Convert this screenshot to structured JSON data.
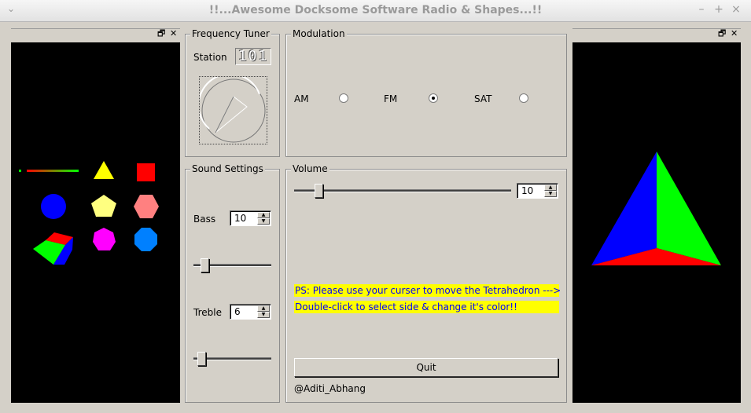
{
  "window": {
    "title": "!!...Awesome Docksome Software Radio & Shapes...!!",
    "minimize": "–",
    "maximize": "+",
    "close": "×",
    "menu": "⌄"
  },
  "left_dock": {
    "float_btn": "🗗",
    "close_btn": "✕"
  },
  "right_dock": {
    "float_btn": "🗗",
    "close_btn": "✕"
  },
  "frequency": {
    "legend": "Frequency Tuner",
    "station_label": "Station",
    "station_value": "101"
  },
  "modulation": {
    "legend": "Modulation",
    "options": [
      {
        "label": "AM",
        "checked": false
      },
      {
        "label": "FM",
        "checked": true
      },
      {
        "label": "SAT",
        "checked": false
      }
    ]
  },
  "sound": {
    "legend": "Sound Settings",
    "bass_label": "Bass",
    "bass_value": "10",
    "treble_label": "Treble",
    "treble_value": "6"
  },
  "volume": {
    "legend": "Volume",
    "value": "10",
    "note1": "PS: Please use your curser to move the Tetrahedron --->",
    "note2": "Double-click to select side & change it's color!!",
    "quit_label": "Quit",
    "author": "@Aditi_Abhang"
  },
  "shapes": [
    {
      "name": "line",
      "color": "#ff0000"
    },
    {
      "name": "triangle",
      "color": "#ffff00"
    },
    {
      "name": "square",
      "color": "#ff0000"
    },
    {
      "name": "circle",
      "color": "#0000ff"
    },
    {
      "name": "pentagon",
      "color": "#ffff80"
    },
    {
      "name": "hexagon",
      "color": "#ff8080"
    },
    {
      "name": "cube",
      "color": "#ff0000"
    },
    {
      "name": "heptagon",
      "color": "#ff00ff"
    },
    {
      "name": "octagon",
      "color": "#0080ff"
    }
  ],
  "tetrahedron": {
    "colors": [
      "#0000ff",
      "#00ff00",
      "#ff0000"
    ]
  }
}
